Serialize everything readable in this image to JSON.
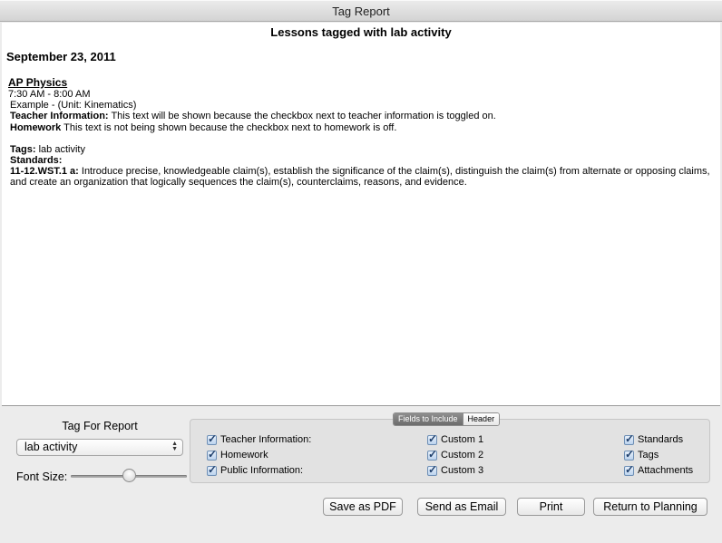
{
  "window": {
    "title": "Tag Report"
  },
  "report": {
    "heading": "Lessons tagged with lab activity",
    "date": "September 23, 2011",
    "lesson": {
      "course": "AP Physics",
      "time": "7:30 AM - 8:00 AM",
      "example": "Example  - (Unit: Kinematics)",
      "teacher_label": "Teacher Information:",
      "teacher_text": " This text will be shown because the checkbox next to teacher information  is toggled on.",
      "homework_label": "Homework",
      "homework_text": " This text is not being shown because the checkbox next to homework is off.",
      "tags_label": "Tags:",
      "tags_text": "  lab activity",
      "standards_label": "Standards:",
      "standard_code": "11-12.WST.1 a:",
      "standard_text": " Introduce precise, knowledgeable claim(s), establish the significance of the claim(s), distinguish the claim(s) from alternate or opposing claims, and create an organization that logically sequences the claim(s), counterclaims, reasons, and evidence."
    }
  },
  "controls": {
    "tag_label": "Tag For Report",
    "tag_selected": "lab activity",
    "font_size_label": "Font Size:",
    "font_size_level": 0.5,
    "tabs": {
      "fields": "Fields to Include",
      "header": "Header"
    },
    "fields": {
      "teacher_info": "Teacher Information:",
      "homework": "Homework",
      "public_info": "Public Information:",
      "custom1": "Custom 1",
      "custom2": "Custom 2",
      "custom3": "Custom 3",
      "standards": "Standards",
      "tags": "Tags",
      "attachments": "Attachments"
    },
    "buttons": {
      "save_pdf": "Save as PDF",
      "send_email": "Send as Email",
      "print": "Print",
      "return": "Return to Planning"
    }
  }
}
